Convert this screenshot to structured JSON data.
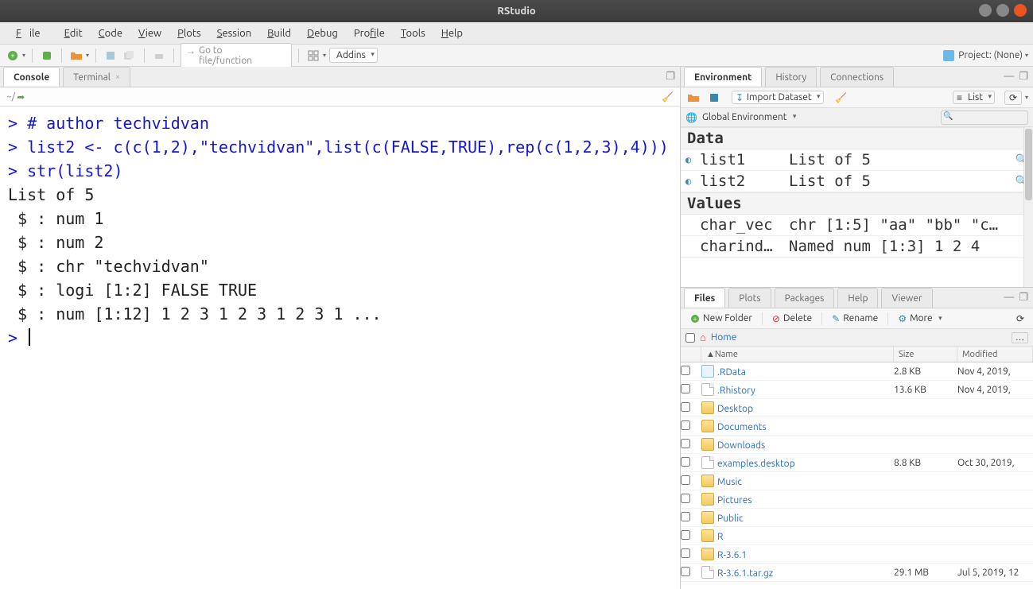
{
  "titlebar": {
    "title": "RStudio"
  },
  "menubar": {
    "items": [
      "File",
      "Edit",
      "Code",
      "View",
      "Plots",
      "Session",
      "Build",
      "Debug",
      "Profile",
      "Tools",
      "Help"
    ]
  },
  "toolbar": {
    "goto_placeholder": "Go to file/function",
    "addins": "Addins",
    "project_label": "Project: (None)"
  },
  "left": {
    "tabs": {
      "console": "Console",
      "terminal": "Terminal"
    },
    "subbar_path": "~/",
    "console_lines": [
      {
        "t": "prompt",
        "text": "> "
      },
      {
        "t": "code",
        "text": "# author techvidvan\n"
      },
      {
        "t": "prompt",
        "text": "> "
      },
      {
        "t": "code",
        "text": "list2 <- c(c(1,2),\"techvidvan\",list(c(FALSE,TRUE),rep(c(1,2,3),4)))\n"
      },
      {
        "t": "prompt",
        "text": "> "
      },
      {
        "t": "code",
        "text": "str(list2)\n"
      },
      {
        "t": "out",
        "text": "List of 5\n"
      },
      {
        "t": "out",
        "text": " $ : num 1\n"
      },
      {
        "t": "out",
        "text": " $ : num 2\n"
      },
      {
        "t": "out",
        "text": " $ : chr \"techvidvan\"\n"
      },
      {
        "t": "out",
        "text": " $ : logi [1:2] FALSE TRUE\n"
      },
      {
        "t": "out",
        "text": " $ : num [1:12] 1 2 3 1 2 3 1 2 3 1 ...\n"
      },
      {
        "t": "prompt",
        "text": "> "
      },
      {
        "t": "cursor"
      }
    ]
  },
  "env": {
    "tabs": {
      "environment": "Environment",
      "history": "History",
      "connections": "Connections"
    },
    "import": "Import Dataset",
    "listbtn": "List",
    "global": "Global Environment",
    "sections": {
      "data_header": "Data",
      "values_header": "Values",
      "data": [
        {
          "name": "list1",
          "val": "List of 5",
          "expand": true,
          "mag": true
        },
        {
          "name": "list2",
          "val": "List of 5",
          "expand": true,
          "mag": true
        }
      ],
      "values": [
        {
          "name": "char_vec",
          "val": "chr [1:5] \"aa\" \"bb\" \"c…"
        },
        {
          "name": "charind…",
          "val": "Named num [1:3] 1 2 4"
        }
      ]
    }
  },
  "files": {
    "tabs": {
      "files": "Files",
      "plots": "Plots",
      "packages": "Packages",
      "help": "Help",
      "viewer": "Viewer"
    },
    "toolbar": {
      "newfolder": "New Folder",
      "delete": "Delete",
      "rename": "Rename",
      "more": "More"
    },
    "breadcrumb_home": "Home",
    "headers": {
      "name": "Name",
      "size": "Size",
      "modified": "Modified"
    },
    "rows": [
      {
        "icon": "r",
        "name": ".RData",
        "size": "2.8 KB",
        "mod": "Nov 4, 2019,"
      },
      {
        "icon": "file",
        "name": ".Rhistory",
        "size": "13.6 KB",
        "mod": "Nov 4, 2019,"
      },
      {
        "icon": "folder",
        "name": "Desktop",
        "size": "",
        "mod": ""
      },
      {
        "icon": "folder",
        "name": "Documents",
        "size": "",
        "mod": ""
      },
      {
        "icon": "folder",
        "name": "Downloads",
        "size": "",
        "mod": ""
      },
      {
        "icon": "file",
        "name": "examples.desktop",
        "size": "8.8 KB",
        "mod": "Oct 30, 2019,"
      },
      {
        "icon": "folder",
        "name": "Music",
        "size": "",
        "mod": ""
      },
      {
        "icon": "folder",
        "name": "Pictures",
        "size": "",
        "mod": ""
      },
      {
        "icon": "folder",
        "name": "Public",
        "size": "",
        "mod": ""
      },
      {
        "icon": "folder",
        "name": "R",
        "size": "",
        "mod": ""
      },
      {
        "icon": "folder",
        "name": "R-3.6.1",
        "size": "",
        "mod": ""
      },
      {
        "icon": "file",
        "name": "R-3.6.1.tar.gz",
        "size": "29.1 MB",
        "mod": "Jul 5, 2019, 12"
      }
    ]
  }
}
